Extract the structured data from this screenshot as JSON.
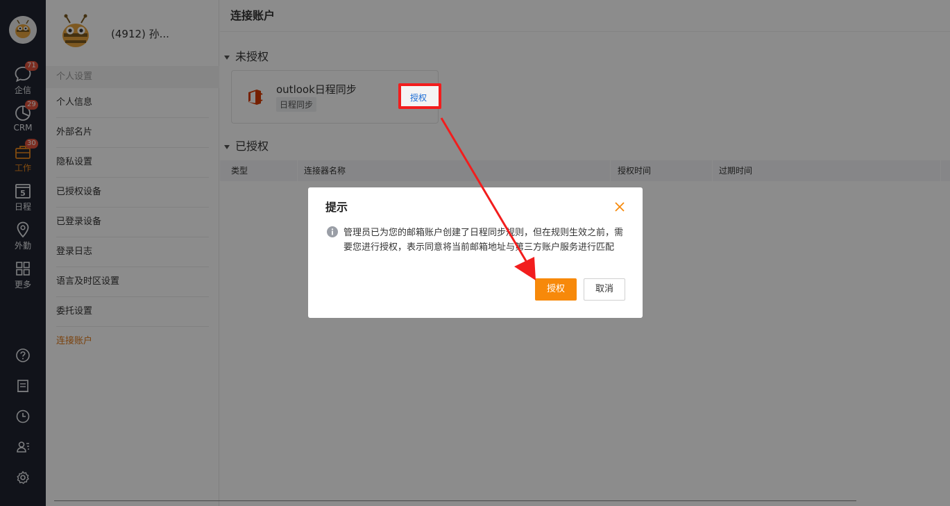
{
  "rail": {
    "items": [
      {
        "label": "企信",
        "badge": "71",
        "icon": "chat-icon"
      },
      {
        "label": "CRM",
        "badge": "29",
        "icon": "pie-chart-icon"
      },
      {
        "label": "工作",
        "badge": "30",
        "icon": "briefcase-icon"
      },
      {
        "label": "日程",
        "day": "5",
        "icon": "calendar-icon"
      },
      {
        "label": "外勤",
        "icon": "location-icon"
      },
      {
        "label": "更多",
        "icon": "grid-icon"
      }
    ],
    "bottom_icons": [
      "help-icon",
      "notebook-icon",
      "clock-icon",
      "contacts-icon",
      "settings-icon"
    ]
  },
  "sidebar": {
    "user_name": "(4912) 孙...",
    "section_title": "个人设置",
    "items": [
      "个人信息",
      "外部名片",
      "隐私设置",
      "已授权设备",
      "已登录设备",
      "登录日志",
      "语言及时区设置",
      "委托设置",
      "连接账户"
    ],
    "active_index": 8
  },
  "main": {
    "title": "连接账户",
    "unauthorized_title": "未授权",
    "card": {
      "title": "outlook日程同步",
      "tag": "日程同步",
      "auth_link": "授权"
    },
    "authorized_title": "已授权",
    "table_columns": [
      "类型",
      "连接器名称",
      "授权时间",
      "过期时间"
    ]
  },
  "dialog": {
    "title": "提示",
    "message": "管理员已为您的邮箱账户创建了日程同步规则，但在规则生效之前，需要您进行授权，表示同意将当前邮箱地址与第三方账户服务进行匹配",
    "confirm_label": "授权",
    "cancel_label": "取消"
  },
  "colors": {
    "accent": "#f7890a",
    "rail_bg": "#1f2431",
    "link": "#1f6fd6",
    "annotation": "#f21d1d"
  }
}
